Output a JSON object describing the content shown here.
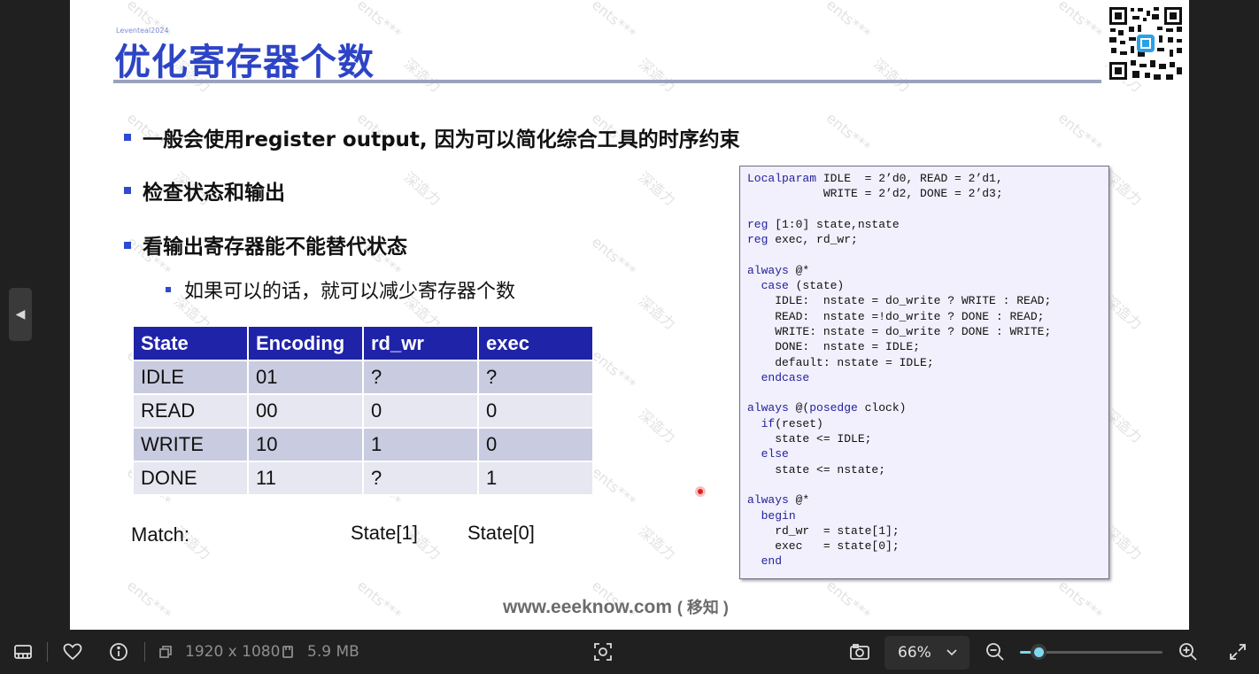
{
  "slide": {
    "tag": "Leventeal2024",
    "title": "优化寄存器个数",
    "bullets": [
      "一般会使用register output, 因为可以简化综合工具的时序约束",
      "检查状态和输出",
      "看输出寄存器能不能替代状态"
    ],
    "sub_bullet": "如果可以的话，就可以减少寄存器个数",
    "table": {
      "headers": [
        "State",
        "Encoding",
        "rd_wr",
        "exec"
      ],
      "rows": [
        [
          "IDLE",
          "01",
          "?",
          "?"
        ],
        [
          "READ",
          "00",
          "0",
          "0"
        ],
        [
          "WRITE",
          "10",
          "1",
          "0"
        ],
        [
          "DONE",
          "11",
          "?",
          "1"
        ]
      ]
    },
    "match": {
      "label": "Match:",
      "col_rd_wr": "State[1]",
      "col_exec": "State[0]"
    },
    "code_lines": [
      "Localparam IDLE  = 2’d0, READ = 2’d1,",
      "           WRITE = 2’d2, DONE = 2’d3;",
      "",
      "reg [1:0] state,nstate",
      "reg exec, rd_wr;",
      "",
      "always @*",
      "  case (state)",
      "    IDLE:  nstate = do_write ? WRITE : READ;",
      "    READ:  nstate =!do_write ? DONE : READ;",
      "    WRITE: nstate = do_write ? DONE : WRITE;",
      "    DONE:  nstate = IDLE;",
      "    default: nstate = IDLE;",
      "  endcase",
      "",
      "always @(posedge clock)",
      "  if(reset)",
      "    state <= IDLE;",
      "  else",
      "    state <= nstate;",
      "",
      "always @*",
      "  begin",
      "    rd_wr  = state[1];",
      "    exec   = state[0];",
      "  end"
    ],
    "footer": {
      "url": "www.eeeknow.com",
      "suffix": "( 移知 )"
    },
    "watermark": {
      "text_a": "ents***",
      "text_b": "深造力"
    }
  },
  "toolbar": {
    "dimensions": "1920 x 1080",
    "file_size": "5.9 MB",
    "zoom": "66%",
    "zoom_slider_fraction": 0.13
  },
  "colors": {
    "title_blue": "#2d44c6",
    "table_header": "#1f23a8",
    "slider_accent": "#7fd8f0"
  }
}
